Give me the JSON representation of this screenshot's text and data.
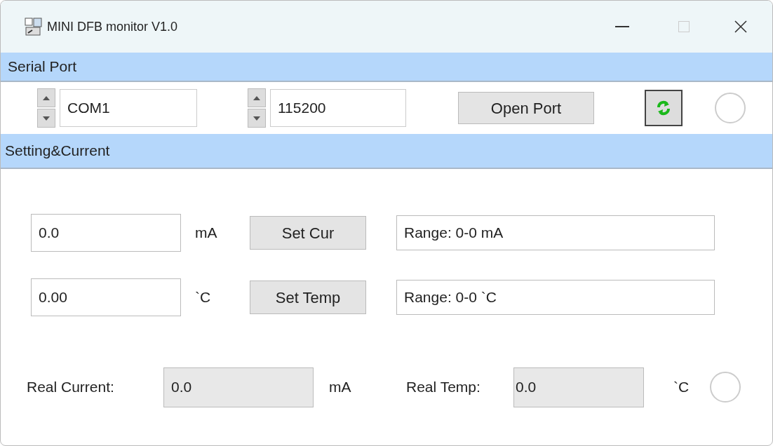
{
  "window": {
    "title": "MINI DFB monitor V1.0"
  },
  "serial_port": {
    "header": "Serial Port",
    "port": "COM1",
    "baud": "115200",
    "open_button": "Open Port"
  },
  "setting": {
    "header": "Setting&Current",
    "rows": [
      {
        "value": "0.0",
        "unit": "mA",
        "button": "Set Cur",
        "range": "Range: 0-0 mA"
      },
      {
        "value": "0.00",
        "unit": "`C",
        "button": "Set Temp",
        "range": "Range: 0-0 `C"
      }
    ],
    "real_current_label": "Real Current:",
    "real_current": "0.0",
    "real_current_unit": "mA",
    "real_temp_label": "Real Temp:",
    "real_temp": "0.0",
    "real_temp_unit": "`C"
  }
}
